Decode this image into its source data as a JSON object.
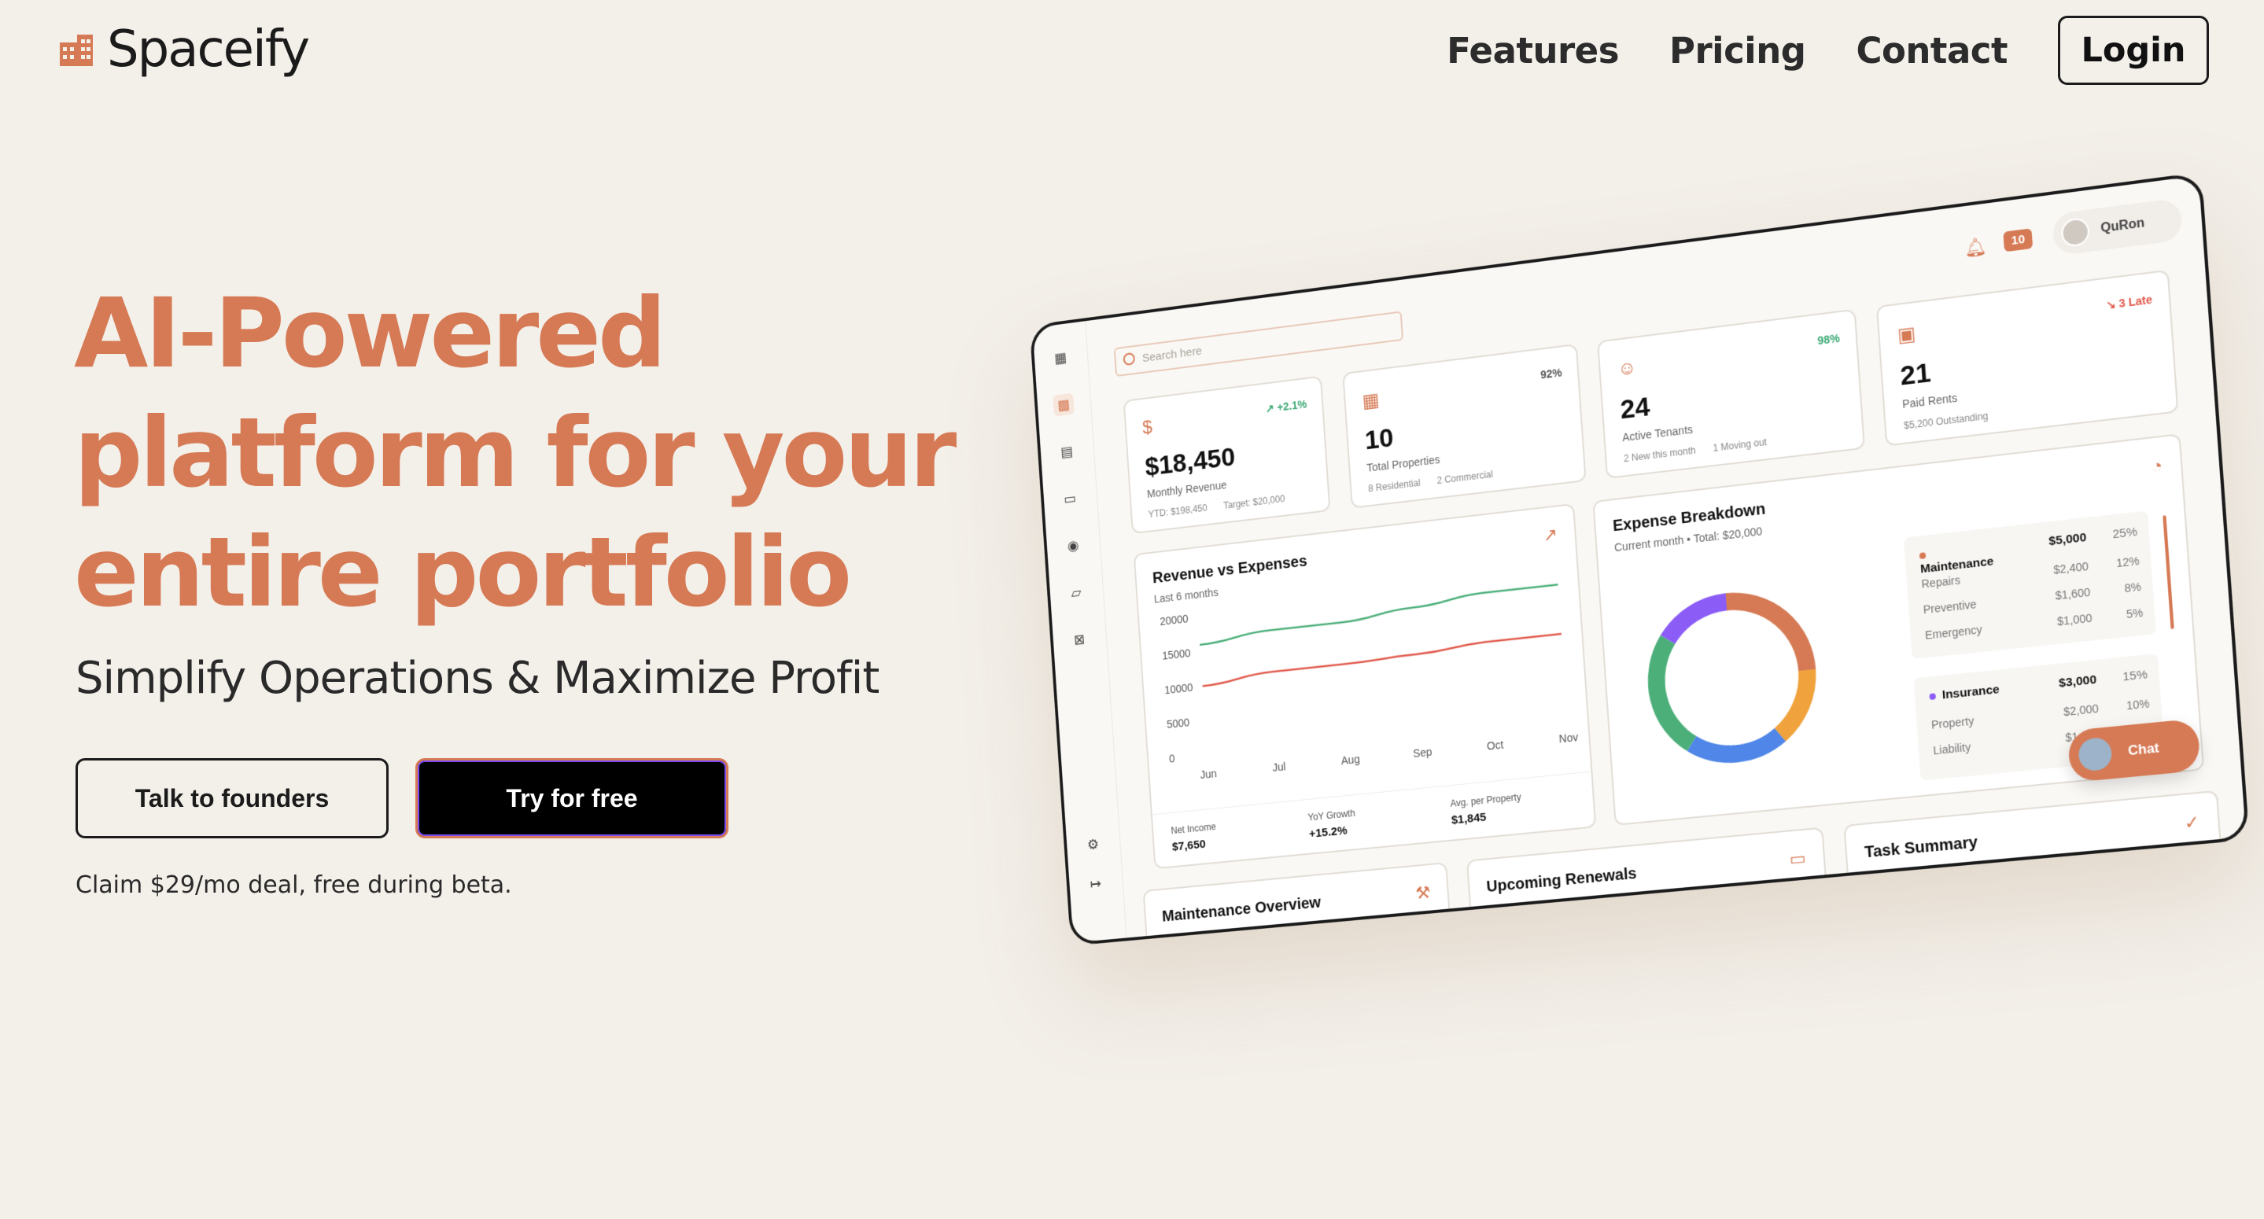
{
  "brand": {
    "name": "Spaceify",
    "accent": "#d67a55"
  },
  "nav": {
    "features": "Features",
    "pricing": "Pricing",
    "contact": "Contact",
    "login": "Login"
  },
  "hero": {
    "title_line1": "AI-Powered",
    "title_line2": "platform for your",
    "title_line3": "entire portfolio",
    "subtitle": "Simplify Operations & Maximize Profit",
    "cta_secondary": "Talk to founders",
    "cta_primary": "Try for free",
    "deal": "Claim $29/mo deal, free during beta."
  },
  "dashboard": {
    "search_placeholder": "Search here",
    "notifications": "10",
    "user": "QuRon",
    "stats": [
      {
        "icon": "dollar-icon",
        "delta": "↗ +2.1%",
        "value": "$18,450",
        "label": "Monthly Revenue",
        "sub": [
          "YTD: $198,450",
          "Target: $20,000"
        ]
      },
      {
        "icon": "building-icon",
        "delta": "92%",
        "value": "10",
        "label": "Total Properties",
        "sub": [
          "8 Residential",
          "2 Commercial"
        ]
      },
      {
        "icon": "users-icon",
        "delta": "98%",
        "value": "24",
        "label": "Active Tenants",
        "sub": [
          "2 New this month",
          "1 Moving out"
        ]
      },
      {
        "icon": "receipt-icon",
        "delta": "↘ 3 Late",
        "value": "21",
        "label": "Paid Rents",
        "sub": [
          "$5,200 Outstanding"
        ]
      }
    ],
    "revenue": {
      "title": "Revenue vs Expenses",
      "subtitle": "Last 6 months",
      "footer": [
        {
          "label": "Net Income",
          "value": "$7,650"
        },
        {
          "label": "YoY Growth",
          "value": "+15.2%"
        },
        {
          "label": "Avg. per Property",
          "value": "$1,845"
        }
      ]
    },
    "expense": {
      "title": "Expense Breakdown",
      "subtitle": "Current month • Total: $20,000",
      "groups": [
        {
          "name": "Maintenance",
          "amount": "$5,000",
          "pct": "25%",
          "color": "#d67a55",
          "items": [
            {
              "name": "Repairs",
              "amount": "$2,400",
              "pct": "12%"
            },
            {
              "name": "Preventive",
              "amount": "$1,600",
              "pct": "8%"
            },
            {
              "name": "Emergency",
              "amount": "$1,000",
              "pct": "5%"
            }
          ]
        },
        {
          "name": "Insurance",
          "amount": "$3,000",
          "pct": "15%",
          "color": "#8b5cf6",
          "items": [
            {
              "name": "Property",
              "amount": "$2,000",
              "pct": "10%"
            },
            {
              "name": "Liability",
              "amount": "$1,000",
              "pct": "5%"
            }
          ]
        }
      ]
    },
    "bottom_cards": [
      "Maintenance Overview",
      "Upcoming Renewals",
      "Task Summary"
    ],
    "chat_label": "Chat"
  },
  "chart_data": [
    {
      "type": "line",
      "title": "Revenue vs Expenses",
      "subtitle": "Last 6 months",
      "categories": [
        "Jun",
        "Jul",
        "Aug",
        "Sep",
        "Oct",
        "Nov"
      ],
      "yticks": [
        0,
        5000,
        10000,
        15000,
        20000
      ],
      "ylim": [
        0,
        20000
      ],
      "series": [
        {
          "values": [
            16000,
            17000,
            17000,
            18000,
            19000,
            19000
          ],
          "color": "#4caf7a"
        },
        {
          "values": [
            10000,
            11000,
            11000,
            11300,
            12000,
            12000
          ],
          "color": "#e0594b"
        }
      ]
    },
    {
      "type": "pie",
      "title": "Expense Breakdown",
      "values": [
        25,
        15,
        20,
        25,
        15
      ],
      "colors": [
        "#d67a55",
        "#f0a33c",
        "#4f86e8",
        "#4caf7a",
        "#8b5cf6"
      ]
    }
  ]
}
